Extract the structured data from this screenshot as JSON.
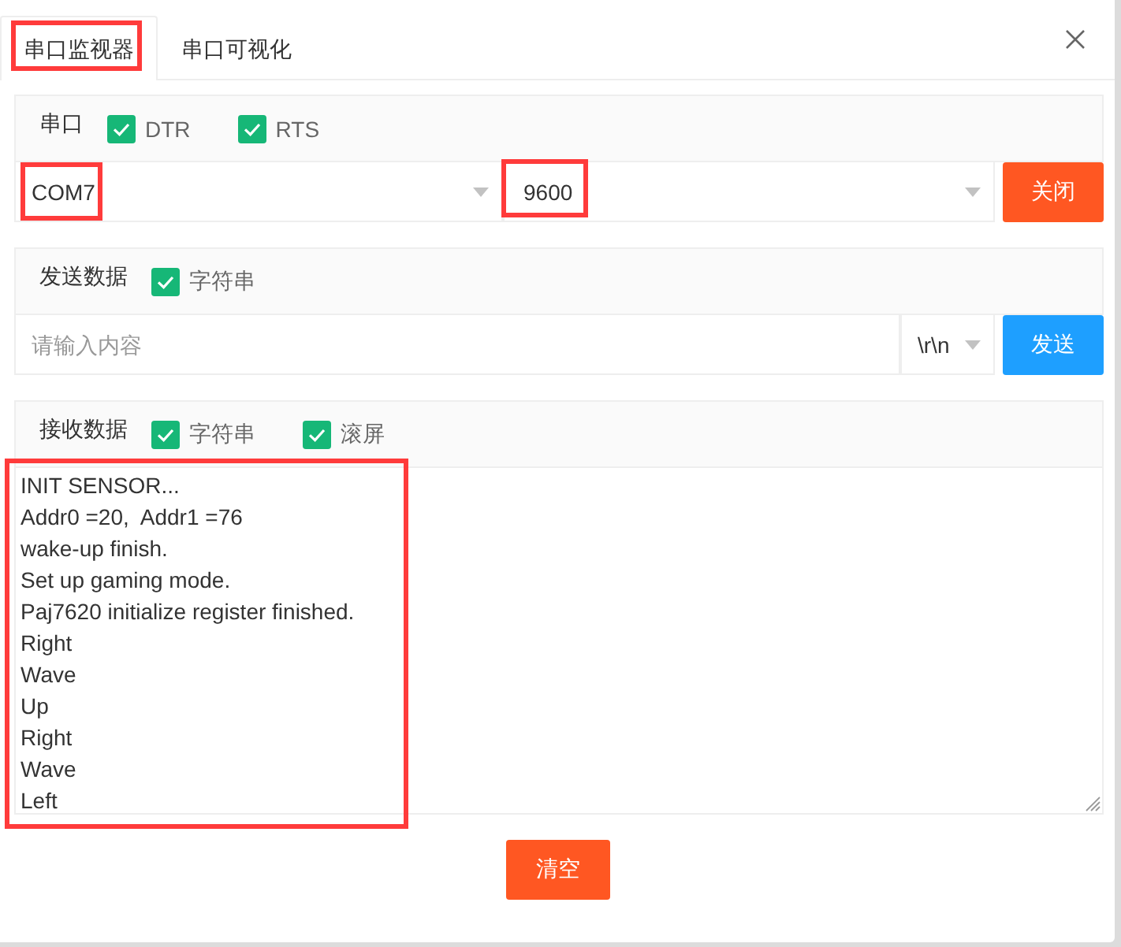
{
  "tabs": [
    {
      "label": "串口监视器",
      "selected": true,
      "highlighted": true
    },
    {
      "label": "串口可视化",
      "selected": false,
      "highlighted": false
    }
  ],
  "serial": {
    "title": "串口",
    "options": [
      {
        "label": "DTR",
        "checked": true
      },
      {
        "label": "RTS",
        "checked": true
      }
    ],
    "port": {
      "value": "COM7",
      "highlighted": true
    },
    "baud_rate": {
      "value": "9600",
      "highlighted": true
    },
    "button": {
      "label": "关闭",
      "kind": "danger"
    }
  },
  "send": {
    "title": "发送数据",
    "options": [
      {
        "label": "字符串",
        "checked": true
      }
    ],
    "input": {
      "placeholder": "请输入内容"
    },
    "line_ending": {
      "value": "\\r\\n"
    },
    "button": {
      "label": "发送",
      "kind": "normal"
    }
  },
  "receive": {
    "title": "接收数据",
    "options": [
      {
        "label": "字符串",
        "checked": true
      },
      {
        "label": "滚屏",
        "checked": true
      }
    ],
    "log": {
      "highlighted": true,
      "lines": [
        "INIT SENSOR...",
        "Addr0 =20,  Addr1 =76",
        "wake-up finish.",
        "Set up gaming mode.",
        "Paj7620 initialize register finished.",
        "Right",
        "Wave",
        "Up",
        "Right",
        "Wave",
        "Left"
      ]
    }
  },
  "clear_button": {
    "label": "清空",
    "kind": "danger"
  }
}
